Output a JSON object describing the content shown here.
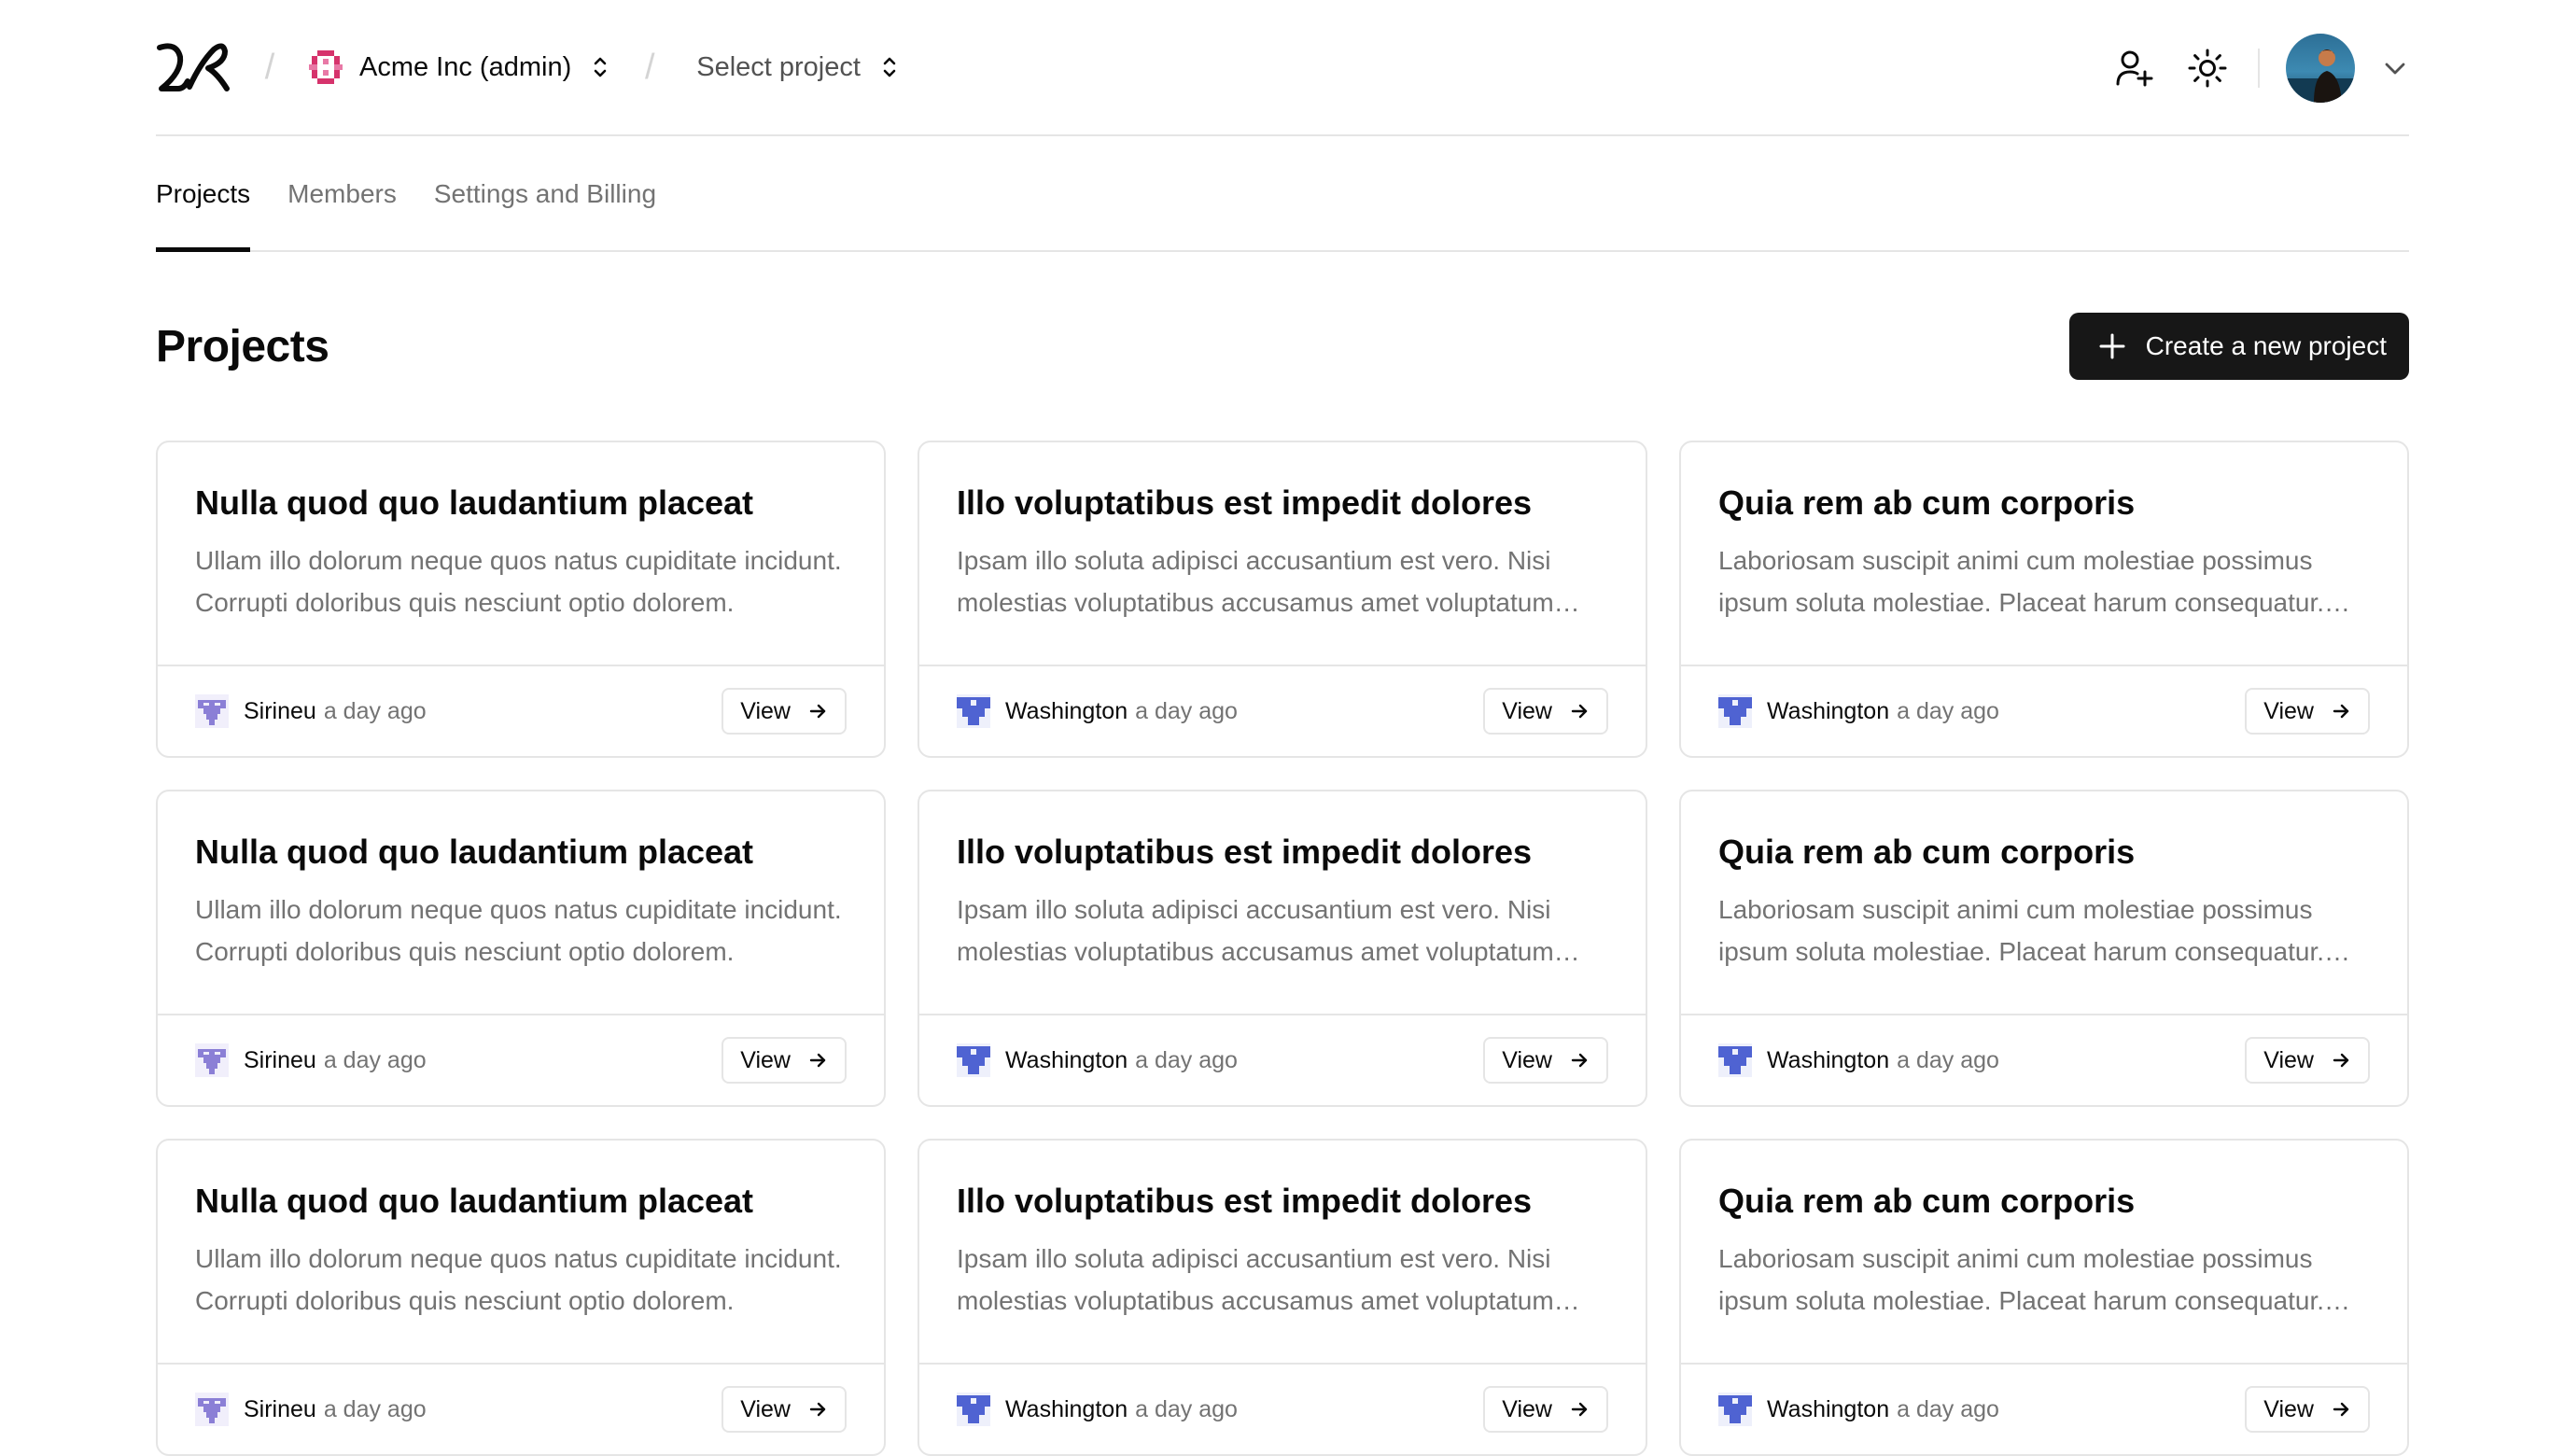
{
  "header": {
    "org_name": "Acme Inc (admin)",
    "project_placeholder": "Select project",
    "icons": {
      "logo": "logo-icon",
      "org": "org-avatar-icon",
      "invite": "user-plus-icon",
      "theme": "sun-icon",
      "user_menu": "chevron-down-icon"
    }
  },
  "tabs": [
    {
      "label": "Projects",
      "active": true
    },
    {
      "label": "Members",
      "active": false
    },
    {
      "label": "Settings and Billing",
      "active": false
    }
  ],
  "page": {
    "title": "Projects",
    "create_button": "Create a new project"
  },
  "colors": {
    "sirineu_avatar": "#8b7fd6",
    "washington_avatar": "#4f63d2",
    "org_avatar": "#d6336c",
    "primary_button": "#171717"
  },
  "projects": [
    {
      "title": "Nulla quod quo laudantium placeat",
      "description": "Ullam illo dolorum neque quos natus cupiditate incidunt. Corrupti doloribus quis nesciunt optio dolorem.",
      "author": "Sirineu",
      "time": "a day ago",
      "view_label": "View",
      "avatar": "sirineu"
    },
    {
      "title": "Illo voluptatibus est impedit dolores",
      "description": "Ipsam illo soluta adipisci accusantium est vero. Nisi molestias voluptatibus accusamus amet voluptatum quia.",
      "author": "Washington",
      "time": "a day ago",
      "view_label": "View",
      "avatar": "washington"
    },
    {
      "title": "Quia rem ab cum corporis",
      "description": "Laboriosam suscipit animi cum molestiae possimus ipsum soluta molestiae. Placeat harum consequatur. Eius quod.",
      "author": "Washington",
      "time": "a day ago",
      "view_label": "View",
      "avatar": "washington"
    },
    {
      "title": "Nulla quod quo laudantium placeat",
      "description": "Ullam illo dolorum neque quos natus cupiditate incidunt. Corrupti doloribus quis nesciunt optio dolorem.",
      "author": "Sirineu",
      "time": "a day ago",
      "view_label": "View",
      "avatar": "sirineu"
    },
    {
      "title": "Illo voluptatibus est impedit dolores",
      "description": "Ipsam illo soluta adipisci accusantium est vero. Nisi molestias voluptatibus accusamus amet voluptatum quia.",
      "author": "Washington",
      "time": "a day ago",
      "view_label": "View",
      "avatar": "washington"
    },
    {
      "title": "Quia rem ab cum corporis",
      "description": "Laboriosam suscipit animi cum molestiae possimus ipsum soluta molestiae. Placeat harum consequatur. Eius quod.",
      "author": "Washington",
      "time": "a day ago",
      "view_label": "View",
      "avatar": "washington"
    },
    {
      "title": "Nulla quod quo laudantium placeat",
      "description": "Ullam illo dolorum neque quos natus cupiditate incidunt. Corrupti doloribus quis nesciunt optio dolorem.",
      "author": "Sirineu",
      "time": "a day ago",
      "view_label": "View",
      "avatar": "sirineu"
    },
    {
      "title": "Illo voluptatibus est impedit dolores",
      "description": "Ipsam illo soluta adipisci accusantium est vero. Nisi molestias voluptatibus accusamus amet voluptatum quia.",
      "author": "Washington",
      "time": "a day ago",
      "view_label": "View",
      "avatar": "washington"
    },
    {
      "title": "Quia rem ab cum corporis",
      "description": "Laboriosam suscipit animi cum molestiae possimus ipsum soluta molestiae. Placeat harum consequatur. Eius quod.",
      "author": "Washington",
      "time": "a day ago",
      "view_label": "View",
      "avatar": "washington"
    }
  ]
}
